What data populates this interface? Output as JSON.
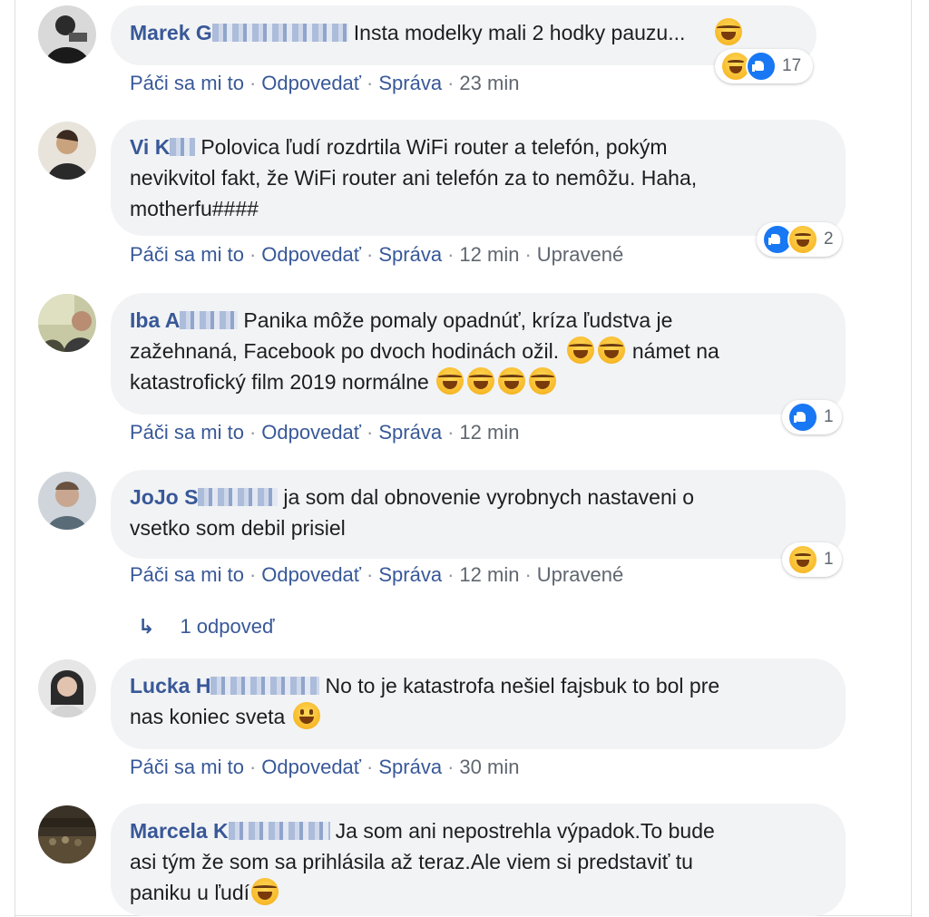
{
  "actions": {
    "like": "Páči sa mi to",
    "reply": "Odpovedať",
    "message": "Správa",
    "sep": "·",
    "edited": "Upravené"
  },
  "comments": [
    {
      "author": "Marek G",
      "text": "Insta modelky mali 2 hodky pauzu...",
      "time": "23 min",
      "reactions": [
        "haha",
        "like"
      ],
      "reaction_count": "17"
    },
    {
      "author": "Vi K",
      "text_lines": [
        "Polovica ľudí rozdrtila WiFi router a telefón, pokým",
        "nevikvitol fakt, že WiFi router ani telefón za to nemôžu. Haha,",
        "motherfu####"
      ],
      "time": "12 min",
      "edited": true,
      "reactions": [
        "like",
        "haha"
      ],
      "reaction_count": "2"
    },
    {
      "author": "Iba A",
      "text_parts": [
        "Panika môže pomaly opadnúť, kríza ľudstva je",
        "zažehnaná, Facebook po dvoch hodinách ožil.",
        "námet na",
        "katastrofický film 2019 normálne"
      ],
      "time": "12 min",
      "reactions": [
        "like"
      ],
      "reaction_count": "1"
    },
    {
      "author": "JoJo S",
      "text_lines": [
        "ja som dal obnovenie vyrobnych nastaveni o",
        "vsetko som debil prisiel"
      ],
      "time": "12 min",
      "edited": true,
      "reactions": [
        "haha"
      ],
      "reaction_count": "1",
      "replies": {
        "arrow": "↳",
        "label": "1 odpoveď"
      }
    },
    {
      "author": "Lucka H",
      "text_lines": [
        "No to je katastrofa nešiel fajsbuk to bol pre",
        "nas koniec sveta"
      ],
      "time": "30 min"
    },
    {
      "author": "Marcela K",
      "text_lines": [
        "Ja som ani nepostrehla výpadok.To bude",
        "asi tým že som sa prihlásila až teraz.Ale viem si predstaviť tu",
        "paniku u ľudí"
      ]
    }
  ]
}
